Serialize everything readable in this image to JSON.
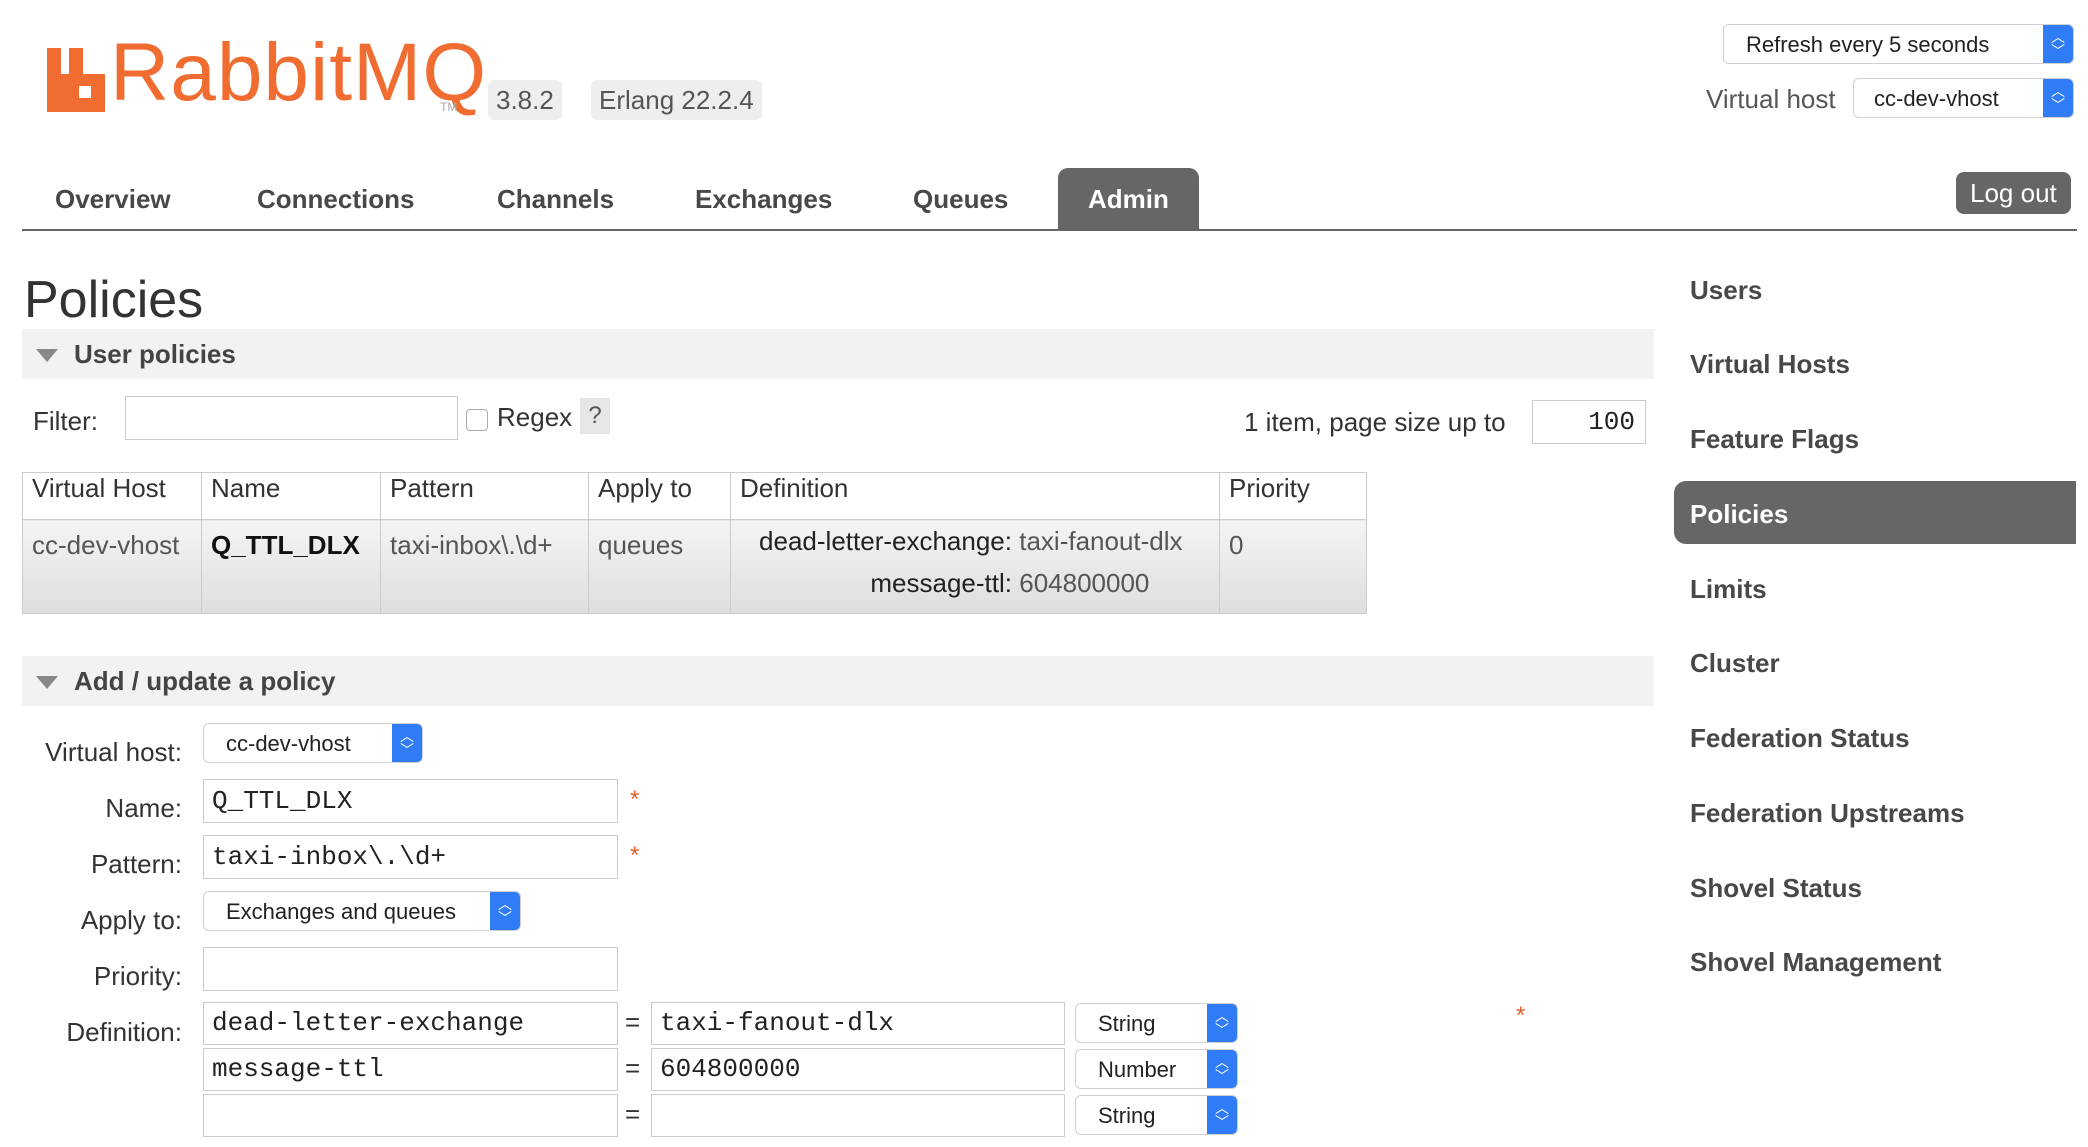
{
  "header": {
    "logo_text": "RabbitMQ",
    "logo_tm": "TM",
    "version": "3.8.2",
    "erlang": "Erlang 22.2.4",
    "refresh_select": "Refresh every 5 seconds",
    "vhost_label": "Virtual host",
    "vhost_select": "cc-dev-vhost",
    "logout_label": "Log out"
  },
  "tabs": [
    {
      "label": "Overview"
    },
    {
      "label": "Connections"
    },
    {
      "label": "Channels"
    },
    {
      "label": "Exchanges"
    },
    {
      "label": "Queues"
    },
    {
      "label": "Admin",
      "active": true
    }
  ],
  "main": {
    "title": "Policies",
    "user_policies": {
      "section_label": "User policies",
      "filter_label": "Filter:",
      "filter_value": "",
      "regex_label": "Regex",
      "regex_checked": false,
      "help_label": "?",
      "page_info": "1 item, page size up to",
      "page_size": "100",
      "table": {
        "headers": [
          "Virtual Host",
          "Name",
          "Pattern",
          "Apply to",
          "Definition",
          "Priority"
        ],
        "rows": [
          {
            "vhost": "cc-dev-vhost",
            "name": "Q_TTL_DLX",
            "pattern": "taxi-inbox\\.\\d+",
            "apply_to": "queues",
            "definition": [
              {
                "key": "dead-letter-exchange:",
                "value": "taxi-fanout-dlx"
              },
              {
                "key": "message-ttl:",
                "value": "604800000"
              }
            ],
            "priority": "0"
          }
        ]
      }
    },
    "add_policy": {
      "section_label": "Add / update a policy",
      "vhost_label": "Virtual host:",
      "vhost_value": "cc-dev-vhost",
      "name_label": "Name:",
      "name_value": "Q_TTL_DLX",
      "pattern_label": "Pattern:",
      "pattern_value": "taxi-inbox\\.\\d+",
      "apply_label": "Apply to:",
      "apply_value": "Exchanges and queues",
      "priority_label": "Priority:",
      "priority_value": "",
      "definition_label": "Definition:",
      "required_mark": "*",
      "equals": "=",
      "definition_rows": [
        {
          "key": "dead-letter-exchange",
          "value": "taxi-fanout-dlx",
          "type": "String"
        },
        {
          "key": "message-ttl",
          "value": "604800000",
          "type": "Number"
        },
        {
          "key": "",
          "value": "",
          "type": "String"
        }
      ]
    }
  },
  "sidebar": {
    "items": [
      {
        "label": "Users"
      },
      {
        "label": "Virtual Hosts"
      },
      {
        "label": "Feature Flags"
      },
      {
        "label": "Policies",
        "active": true
      },
      {
        "label": "Limits"
      },
      {
        "label": "Cluster"
      },
      {
        "label": "Federation Status"
      },
      {
        "label": "Federation Upstreams"
      },
      {
        "label": "Shovel Status"
      },
      {
        "label": "Shovel Management"
      }
    ]
  },
  "colors": {
    "brand": "#f06c30",
    "active_tab": "#666666",
    "select_accent": "#2f7cf6"
  }
}
